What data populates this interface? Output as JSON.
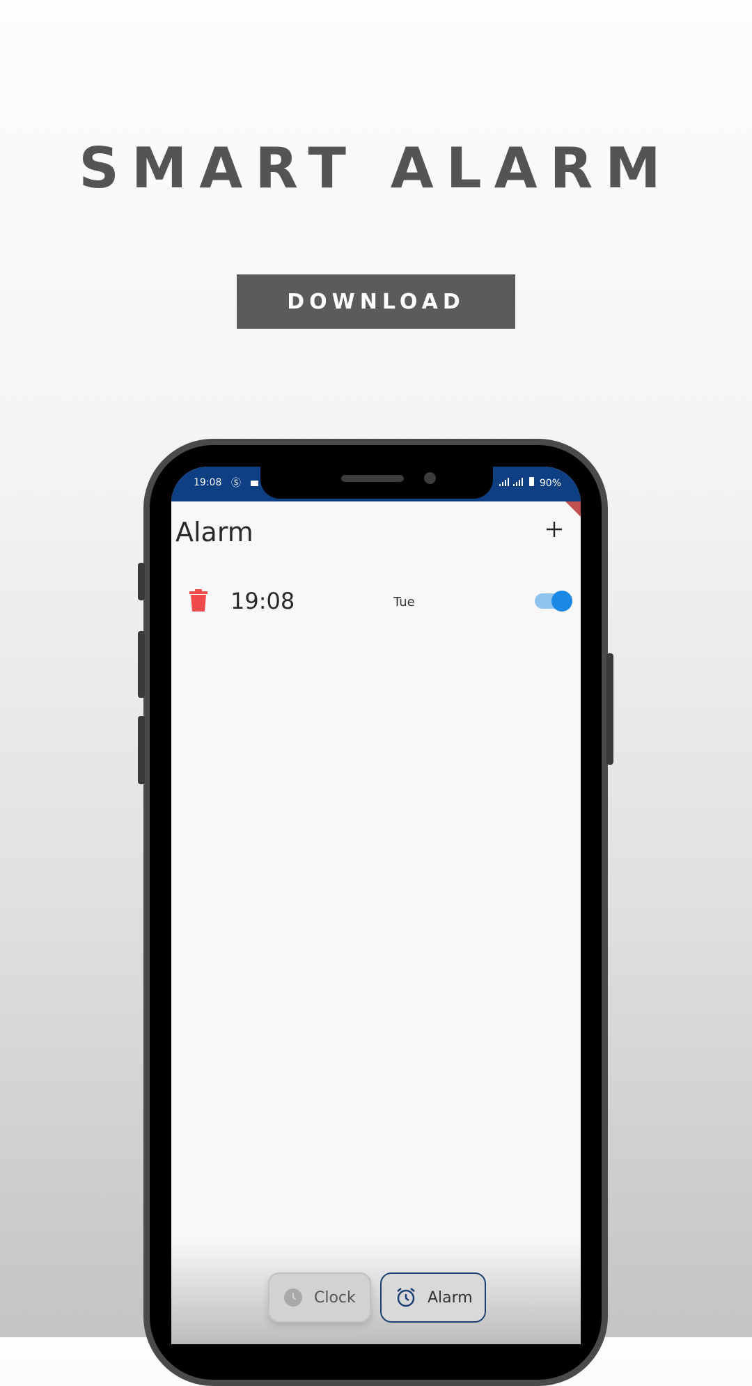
{
  "promo": {
    "headline": "SMART ALARM",
    "download_label": "DOWNLOAD"
  },
  "status_bar": {
    "time": "19:08",
    "battery": "90%",
    "background_color": "#0d3f82"
  },
  "app": {
    "title": "Alarm",
    "add_icon": "plus-icon"
  },
  "alarms": [
    {
      "time": "19:08",
      "days": "Tue",
      "enabled": true,
      "delete_icon": "trash-icon"
    }
  ],
  "bottom_nav": {
    "tabs": [
      {
        "label": "Clock",
        "icon": "clock-icon",
        "selected": false
      },
      {
        "label": "Alarm",
        "icon": "alarm-clock-icon",
        "selected": true
      }
    ]
  },
  "colors": {
    "accent": "#1a88e6",
    "delete": "#f04b4b",
    "nav_border": "#1d4173"
  }
}
